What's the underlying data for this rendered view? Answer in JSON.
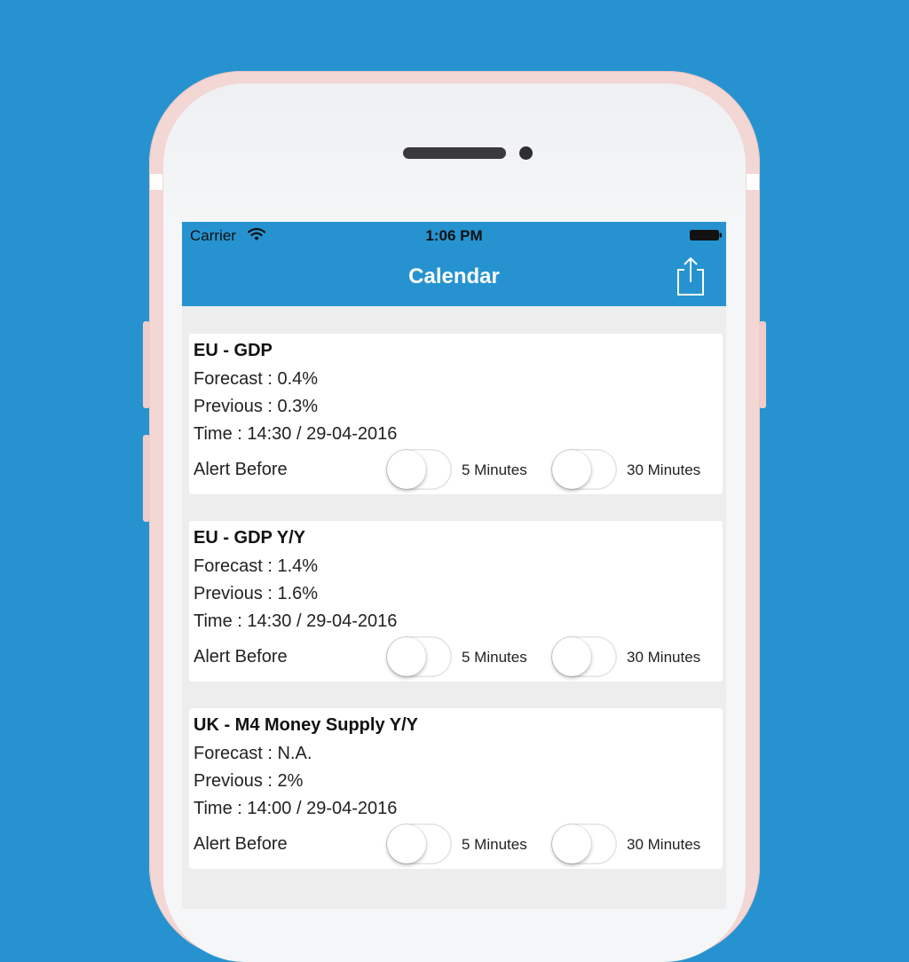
{
  "status_bar": {
    "carrier": "Carrier",
    "time": "1:06 PM",
    "icons": [
      "wifi-icon",
      "battery-icon"
    ]
  },
  "navbar": {
    "title": "Calendar",
    "share_icon": "share-icon"
  },
  "colors": {
    "accent": "#2693d0",
    "background": "#ededed",
    "card": "#ffffff",
    "phone_frame": "#f3d7d5"
  },
  "events": [
    {
      "title": "EU - GDP",
      "forecast": "Forecast : 0.4%",
      "previous": "Previous : 0.3%",
      "time": "Time : 14:30 / 29-04-2016",
      "alert_label": "Alert Before",
      "alert_5": {
        "label": "5 Minutes",
        "on": false
      },
      "alert_30": {
        "label": "30 Minutes",
        "on": false
      }
    },
    {
      "title": "EU - GDP Y/Y",
      "forecast": "Forecast : 1.4%",
      "previous": "Previous : 1.6%",
      "time": "Time : 14:30 / 29-04-2016",
      "alert_label": "Alert Before",
      "alert_5": {
        "label": "5 Minutes",
        "on": false
      },
      "alert_30": {
        "label": "30 Minutes",
        "on": false
      }
    },
    {
      "title": "UK - M4 Money Supply Y/Y",
      "forecast": "Forecast : N.A.",
      "previous": "Previous : 2%",
      "time": "Time : 14:00 / 29-04-2016",
      "alert_label": "Alert Before",
      "alert_5": {
        "label": "5 Minutes",
        "on": false
      },
      "alert_30": {
        "label": "30 Minutes",
        "on": false
      }
    }
  ]
}
